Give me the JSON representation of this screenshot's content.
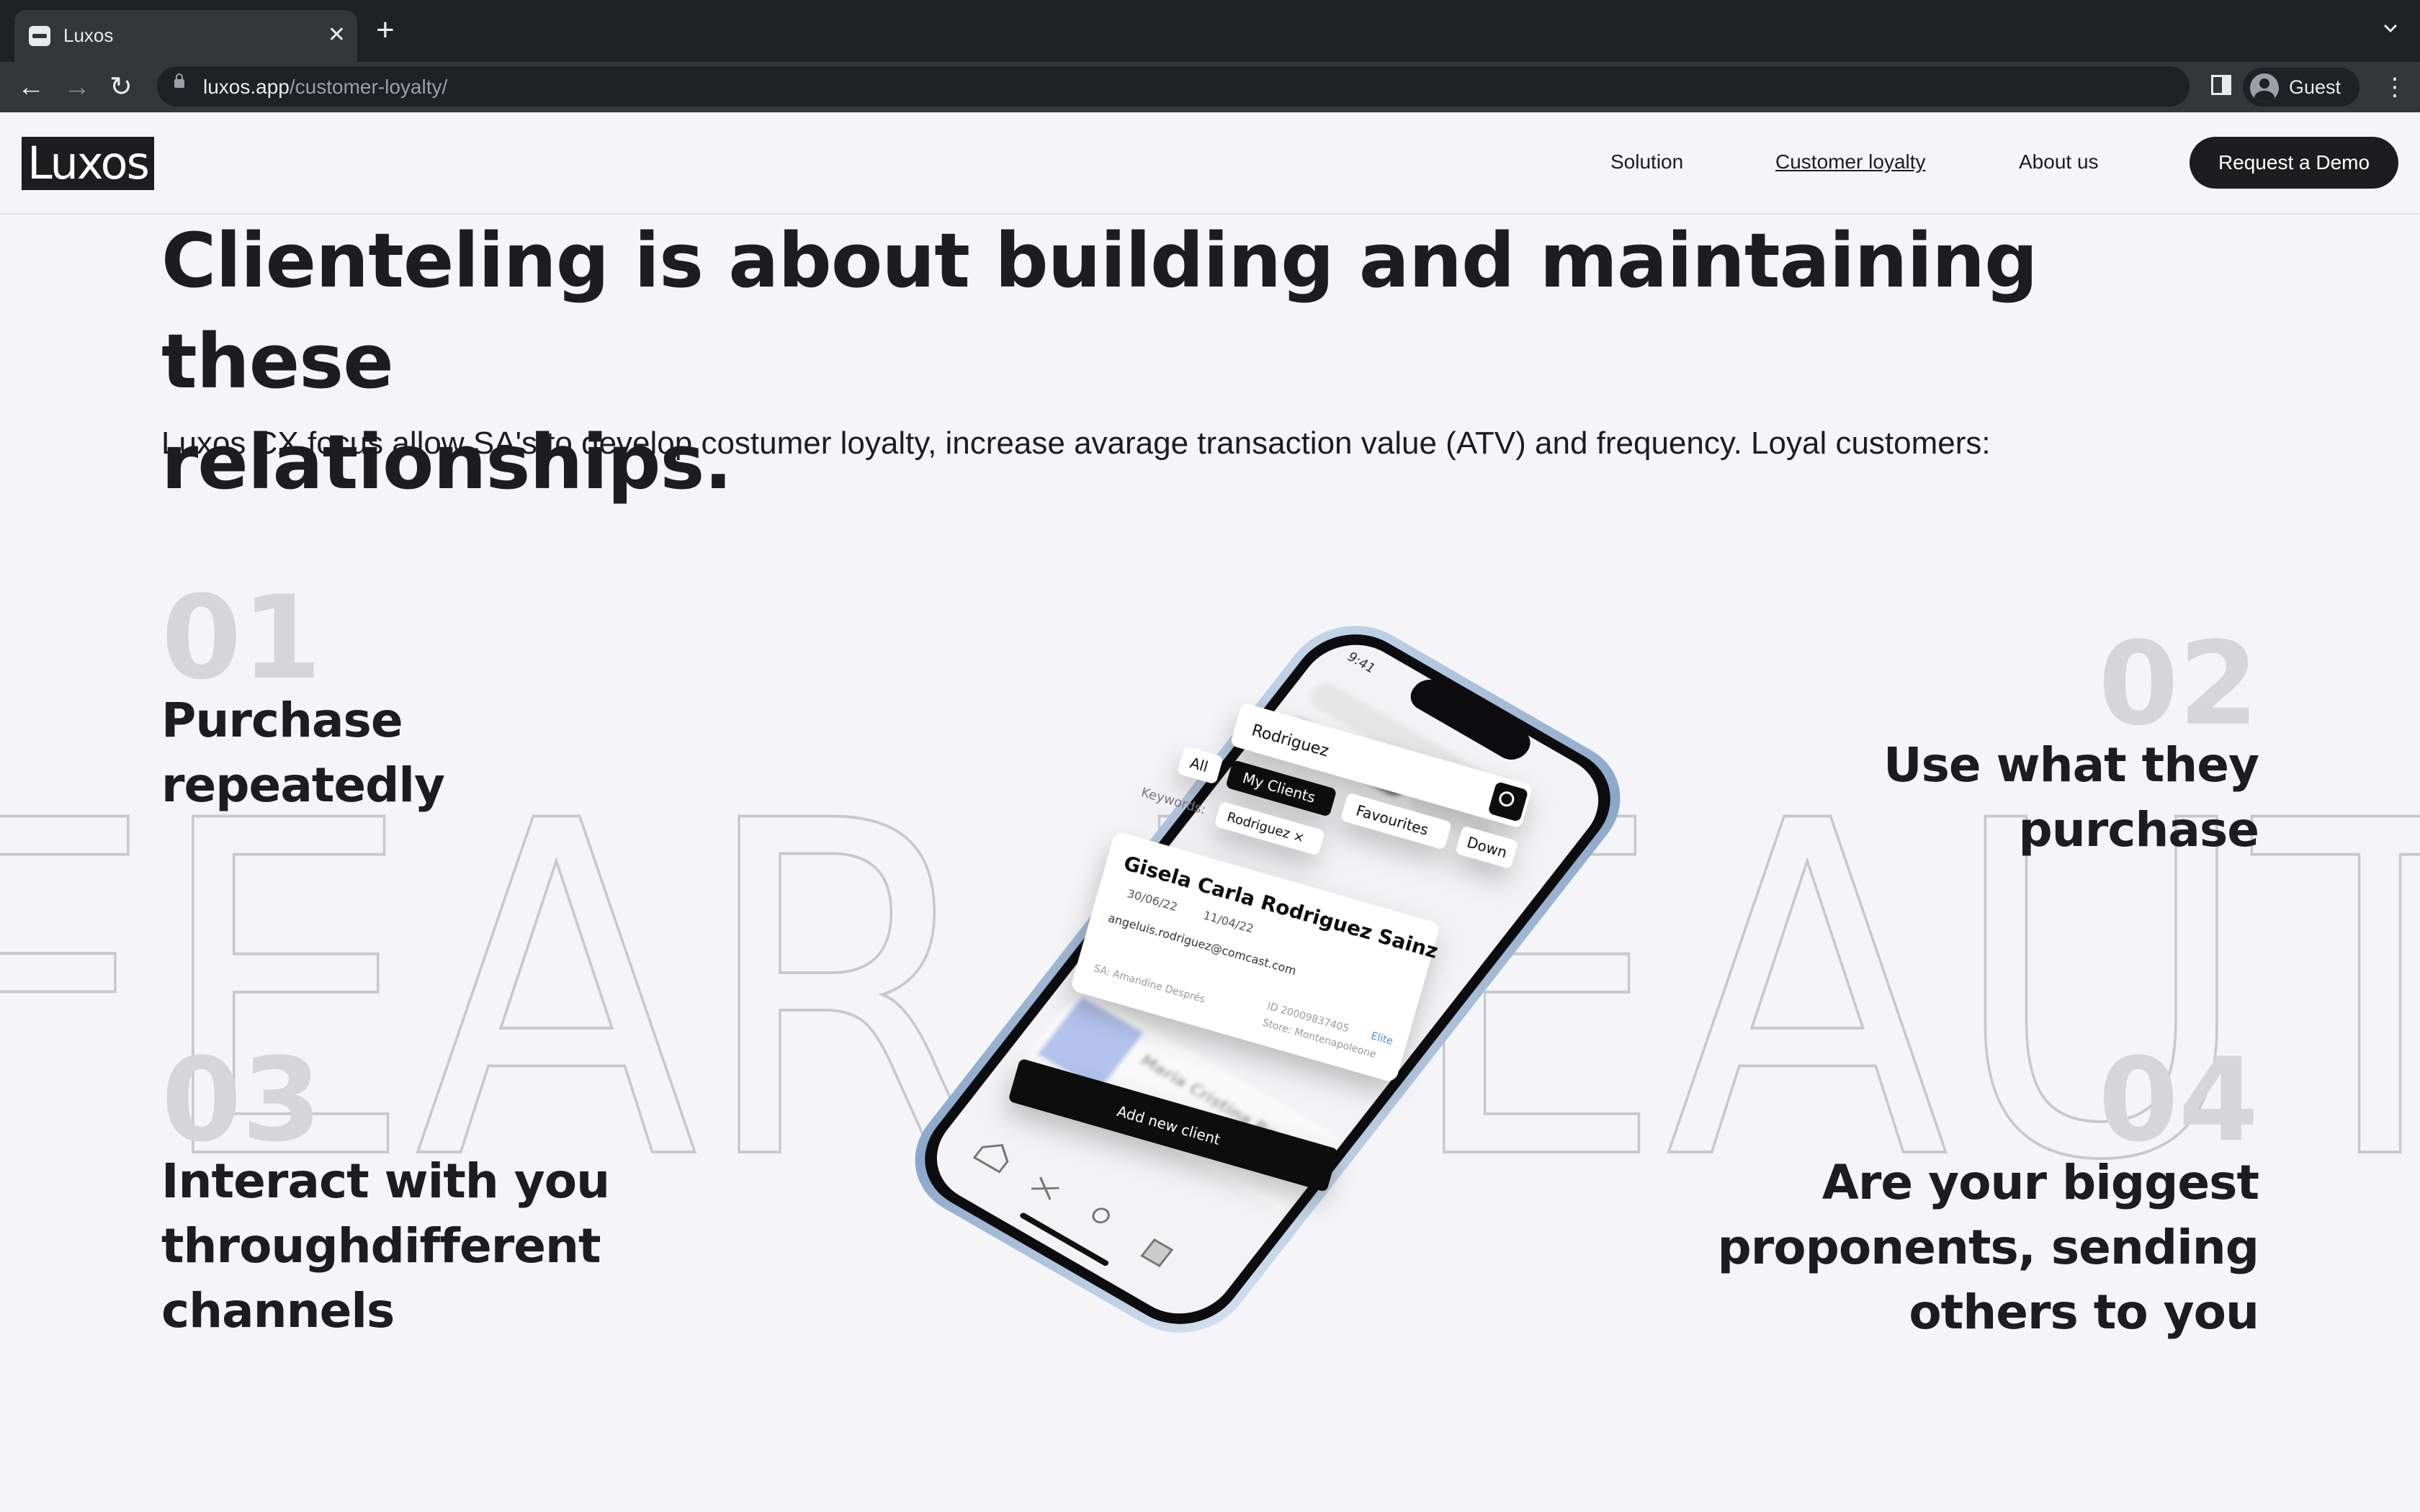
{
  "browser": {
    "tab_title": "Luxos",
    "tab_close": "✕",
    "new_tab": "+",
    "url_host": "luxos.app",
    "url_path": "/customer-loyalty/",
    "profile_name": "Guest",
    "back_icon": "←",
    "forward_icon": "→",
    "reload_icon": "↻",
    "menu_icon": "⋮"
  },
  "site": {
    "logo": "Luxos",
    "nav": [
      "Solution",
      "Customer loyalty",
      "About us"
    ],
    "cta": "Request a Demo"
  },
  "hero": {
    "headline_line1": "Clienteling is about building and maintaining these",
    "headline_line2": "relationships.",
    "subtext": "Luxos CX focus allow SA's to develop costumer loyalty, increase avarage transaction value (ATV) and frequency. Loyal customers:",
    "background_word": "FEAR   BEAUT"
  },
  "points": [
    {
      "number": "01",
      "line1": "Purchase",
      "line2": "repeatedly",
      "line3": ""
    },
    {
      "number": "02",
      "line1": "Use what they",
      "line2": "purchase",
      "line3": ""
    },
    {
      "number": "03",
      "line1": "Interact with you",
      "line2": "throughdifferent",
      "line3": "channels"
    },
    {
      "number": "04",
      "line1": "Are your biggest",
      "line2": "proponents, sending",
      "line3": "others to you"
    }
  ],
  "phone": {
    "search_value": "Rodriguez",
    "chips": [
      "All",
      "My Clients",
      "Favourites",
      "Down"
    ],
    "keywords_label": "Keywords:",
    "keyword_chip": "Rodriguez ×",
    "client_name": "Gisela Carla Rodriguez Sainz",
    "client_date1": "30/06/22",
    "client_date2": "11/04/22",
    "client_email": "angeluis.rodriguez@comcast.com",
    "client_sa": "SA: Amandine Després",
    "client_id": "ID 20009837405",
    "client_store": "Store: Montenapoleone",
    "client_tier": "Elite",
    "second_client": "Maria Cristina Rodriguez",
    "add_button": "Add new client",
    "status_time": "9:41"
  },
  "colors": {
    "chrome_dark": "#202124",
    "chrome_mid": "#35363a",
    "page_bg": "#f5f5f7",
    "text": "#1d1d1f",
    "number_gray": "#d6d6d9",
    "outline_gray": "#c9c9cd",
    "phone_frame": "#a9c0dc"
  }
}
